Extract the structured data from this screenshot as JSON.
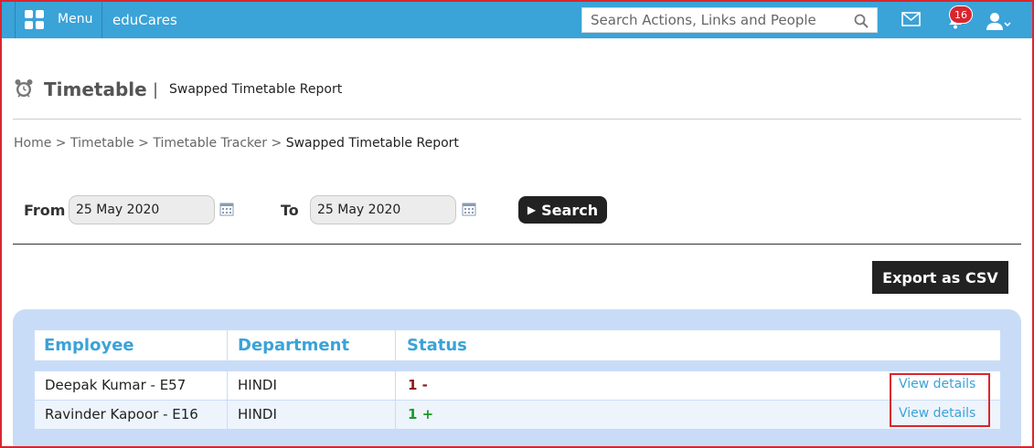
{
  "topbar": {
    "menu_label": "Menu",
    "brand": "eduCares",
    "search_placeholder": "Search Actions, Links and People",
    "notification_count": "16",
    "bar_color": "#3aa3d8"
  },
  "header": {
    "title": "Timetable",
    "separator": "|",
    "subtitle": "Swapped Timetable Report"
  },
  "breadcrumb": {
    "items": [
      "Home",
      "Timetable",
      "Timetable Tracker",
      "Swapped Timetable Report"
    ],
    "separator": ">"
  },
  "filter": {
    "from_label": "From",
    "from_value": "25 May 2020",
    "to_label": "To",
    "to_value": "25 May 2020",
    "search_label": "Search"
  },
  "export_label": "Export as CSV",
  "table": {
    "columns": [
      "Employee",
      "Department",
      "Status"
    ],
    "rows": [
      {
        "employee": "Deepak Kumar - E57",
        "department": "HINDI",
        "status": "1 -",
        "action": "View details"
      },
      {
        "employee": "Ravinder Kapoor - E16",
        "department": "HINDI",
        "status": "1 +",
        "action": "View details"
      }
    ]
  },
  "colors": {
    "accent": "#3aa3d8",
    "highlight": "#d9262e",
    "status_negative": "#8b1a1a",
    "status_positive": "#1a9a2a"
  }
}
